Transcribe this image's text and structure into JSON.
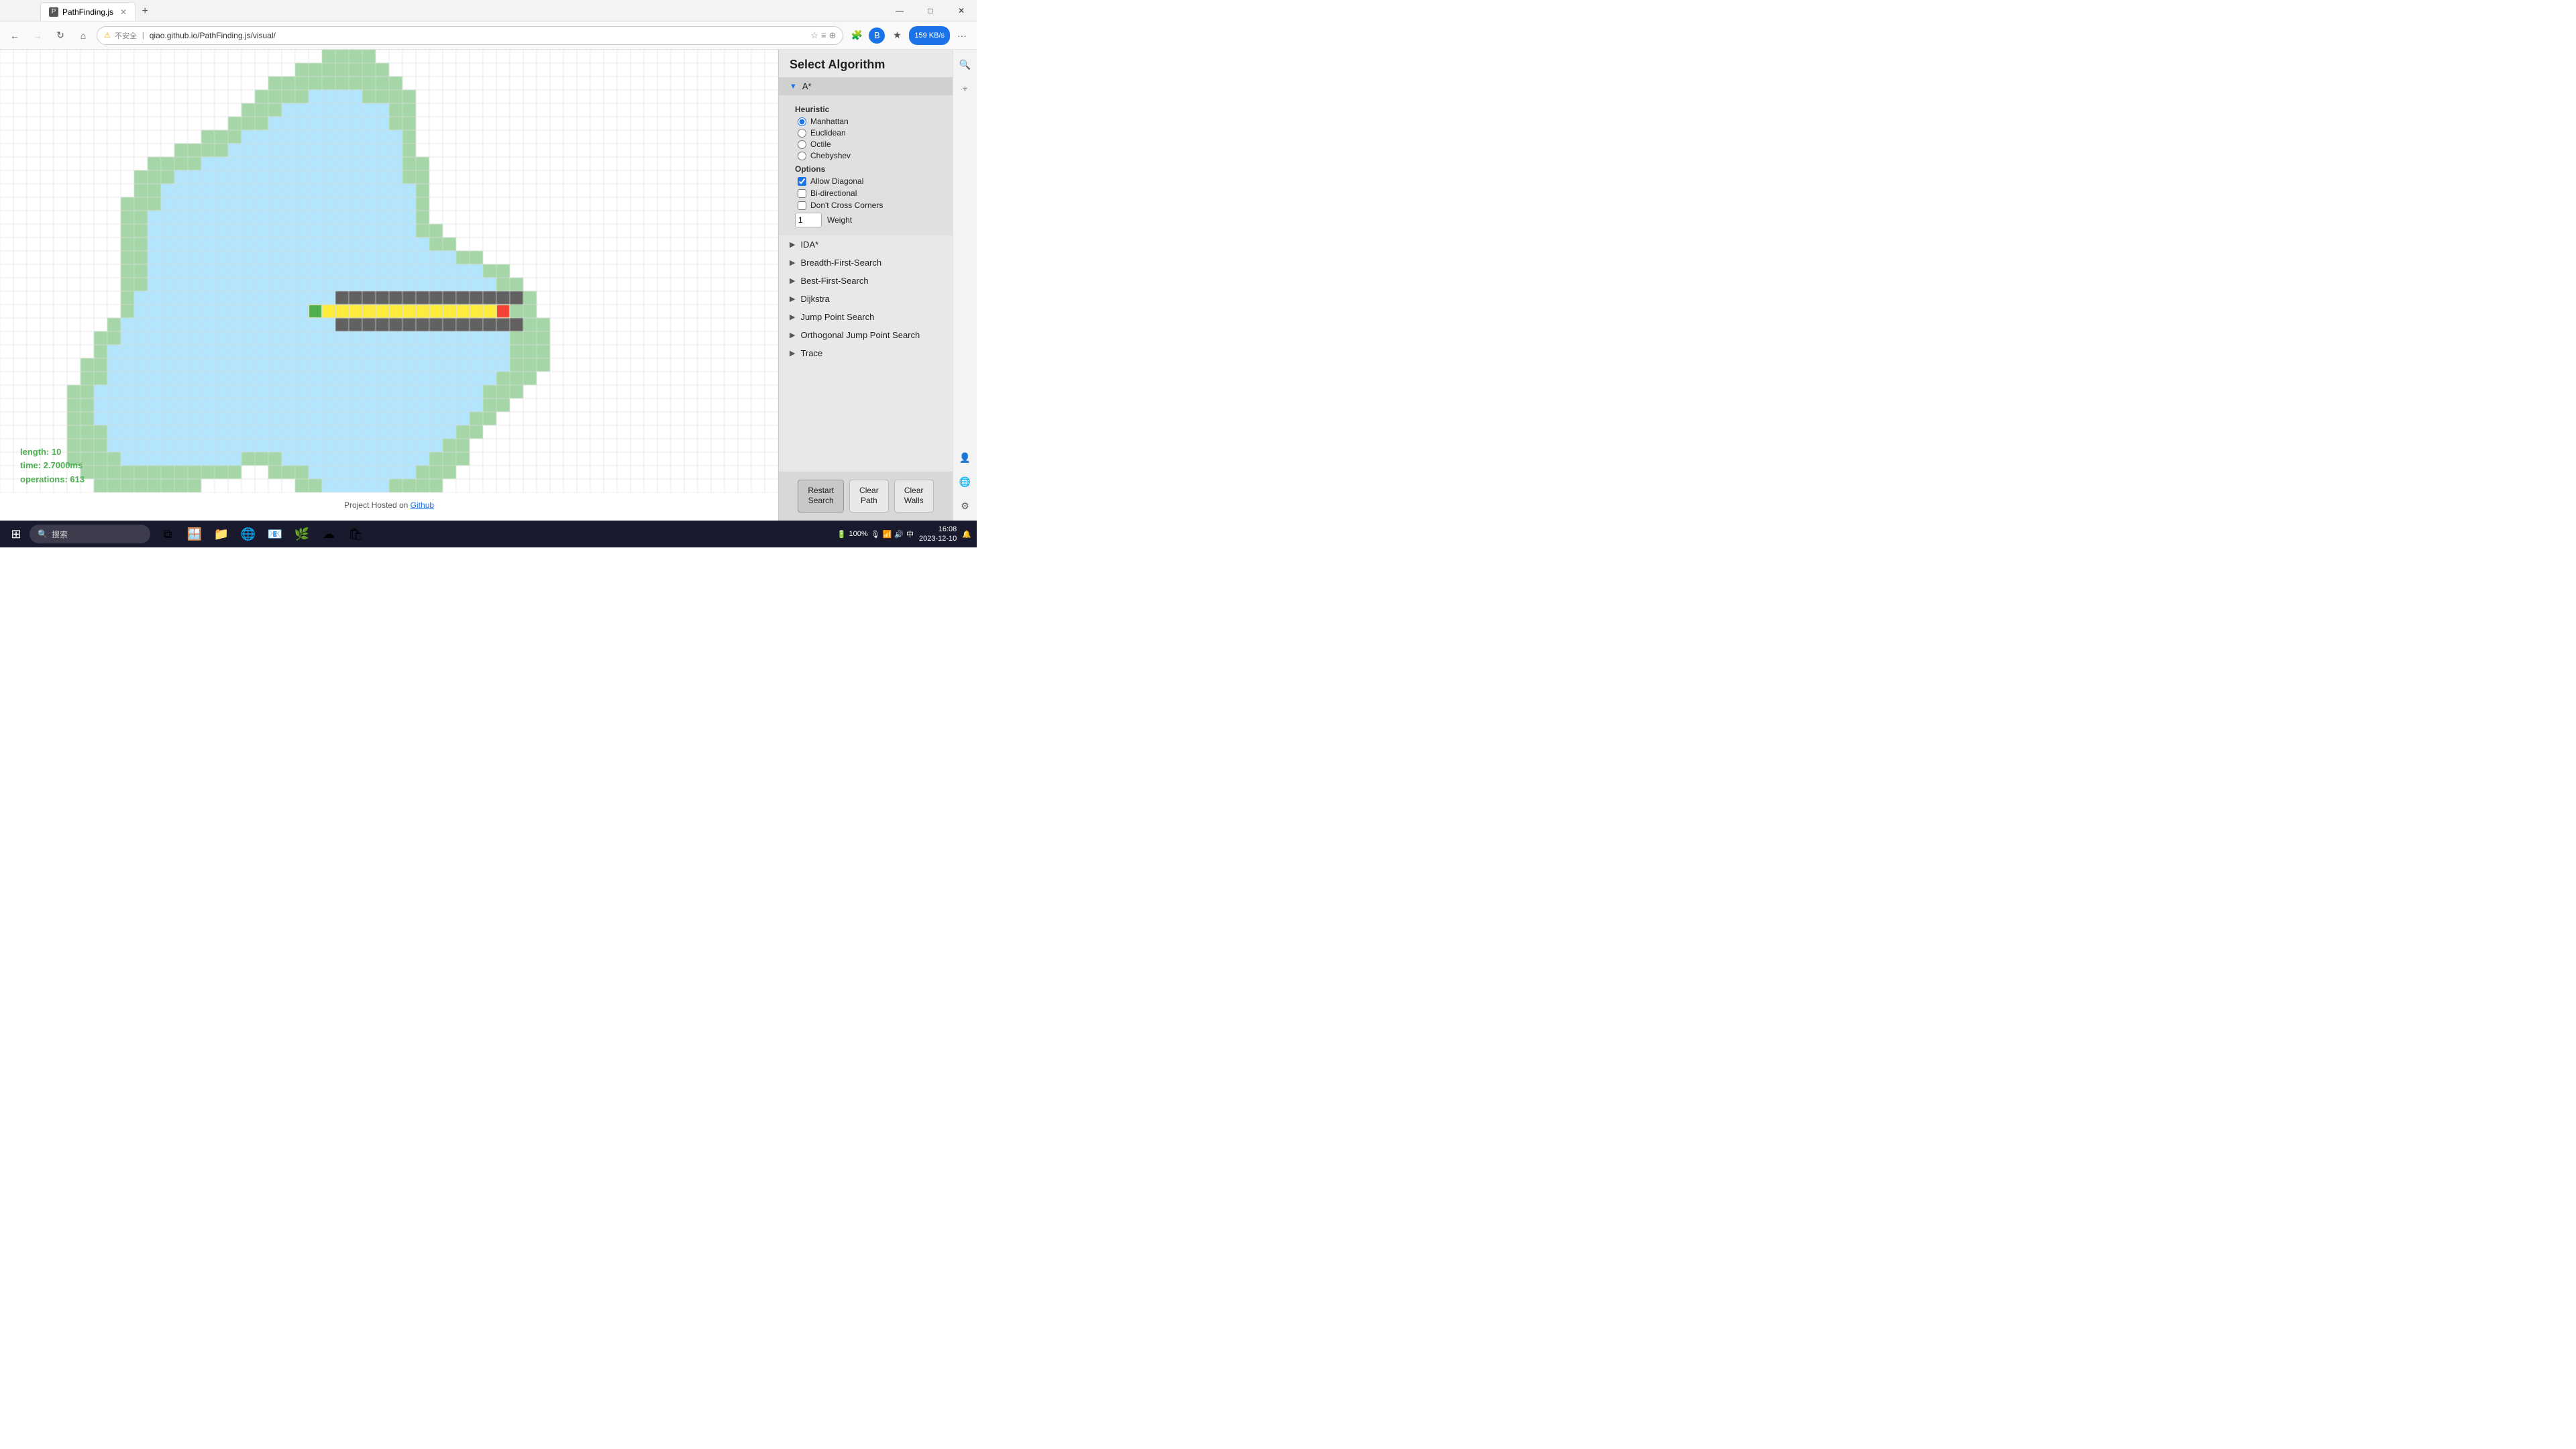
{
  "browser": {
    "tab_title": "PathFinding.js",
    "tab_favicon": "P",
    "address": "qiao.github.io/PathFinding.js/visual/",
    "address_lock_label": "不安全",
    "download_label": "159 KB/s",
    "nav": {
      "back": "←",
      "forward": "→",
      "refresh": "↻",
      "home": "⌂"
    },
    "controls": {
      "minimize": "—",
      "maximize": "□",
      "close": "✕"
    }
  },
  "panel": {
    "title": "Select Algorithm",
    "algorithms": [
      {
        "id": "astar",
        "label": "A*",
        "expanded": true
      },
      {
        "id": "ida",
        "label": "IDA*",
        "expanded": false
      },
      {
        "id": "bfs",
        "label": "Breadth-First-Search",
        "expanded": false
      },
      {
        "id": "best",
        "label": "Best-First-Search",
        "expanded": false
      },
      {
        "id": "dijkstra",
        "label": "Dijkstra",
        "expanded": false
      },
      {
        "id": "jps",
        "label": "Jump Point Search",
        "expanded": false
      },
      {
        "id": "ojps",
        "label": "Orthogonal Jump Point Search",
        "expanded": false
      },
      {
        "id": "trace",
        "label": "Trace",
        "expanded": false
      }
    ],
    "heuristic_label": "Heuristic",
    "heuristics": [
      {
        "id": "manhattan",
        "label": "Manhattan",
        "selected": true
      },
      {
        "id": "euclidean",
        "label": "Euclidean",
        "selected": false
      },
      {
        "id": "octile",
        "label": "Octile",
        "selected": false
      },
      {
        "id": "chebyshev",
        "label": "Chebyshev",
        "selected": false
      }
    ],
    "options_label": "Options",
    "options": [
      {
        "id": "allow_diagonal",
        "label": "Allow Diagonal",
        "checked": true
      },
      {
        "id": "bi_directional",
        "label": "Bi-directional",
        "checked": false
      },
      {
        "id": "dont_cross_corners",
        "label": "Don't Cross Corners",
        "checked": false
      }
    ],
    "weight_label": "Weight",
    "weight_value": "1"
  },
  "buttons": {
    "restart": "Restart\nSearch",
    "clear_path": "Clear\nPath",
    "clear_walls": "Clear\nWalls"
  },
  "stats": {
    "length": "length: 10",
    "time": "time: 2.7000ms",
    "operations": "operations: 613"
  },
  "footer": {
    "text": "Project Hosted on ",
    "link_text": "Github",
    "link_href": "#"
  },
  "taskbar": {
    "search_placeholder": "搜索",
    "time": "16:08",
    "date": "2023-12-10",
    "battery": "100%"
  },
  "grid": {
    "cell_size": 20,
    "cols": 52,
    "rows": 38
  }
}
